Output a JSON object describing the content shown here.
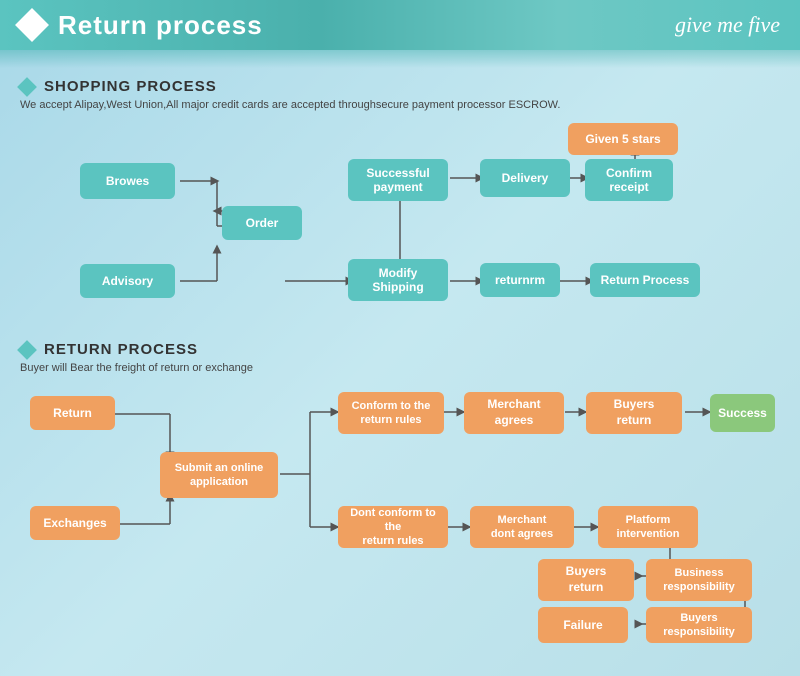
{
  "header": {
    "title": "Return process",
    "logo": "give me five"
  },
  "shopping_section": {
    "title": "SHOPPING PROCESS",
    "subtitle": "We accept Alipay,West Union,All major credit cards are accepted throughsecure payment processor ESCROW.",
    "boxes": [
      {
        "id": "browes",
        "label": "Browes",
        "type": "teal"
      },
      {
        "id": "order",
        "label": "Order",
        "type": "teal"
      },
      {
        "id": "advisory",
        "label": "Advisory",
        "type": "teal"
      },
      {
        "id": "successful_payment",
        "label": "Successful\npayment",
        "type": "teal"
      },
      {
        "id": "modify_shipping",
        "label": "Modify\nShipping",
        "type": "teal"
      },
      {
        "id": "delivery",
        "label": "Delivery",
        "type": "teal"
      },
      {
        "id": "confirm_receipt",
        "label": "Confirm\nreceipt",
        "type": "teal"
      },
      {
        "id": "given_5_stars",
        "label": "Given 5 stars",
        "type": "orange"
      },
      {
        "id": "returnrm",
        "label": "returnrm",
        "type": "teal"
      },
      {
        "id": "return_process",
        "label": "Return Process",
        "type": "teal"
      }
    ]
  },
  "return_section": {
    "title": "RETURN PROCESS",
    "subtitle": "Buyer will Bear the freight of return or exchange",
    "boxes": [
      {
        "id": "return",
        "label": "Return",
        "type": "orange"
      },
      {
        "id": "exchanges",
        "label": "Exchanges",
        "type": "orange"
      },
      {
        "id": "submit_online",
        "label": "Submit an online\napplication",
        "type": "orange"
      },
      {
        "id": "conform_rules",
        "label": "Conform to the\nreturn rules",
        "type": "orange"
      },
      {
        "id": "dont_conform",
        "label": "Dont conform to the\nreturn rules",
        "type": "orange"
      },
      {
        "id": "merchant_agrees",
        "label": "Merchant\nagrees",
        "type": "orange"
      },
      {
        "id": "merchant_dont",
        "label": "Merchant\ndont agrees",
        "type": "orange"
      },
      {
        "id": "buyers_return1",
        "label": "Buyers\nreturn",
        "type": "orange"
      },
      {
        "id": "platform",
        "label": "Platform\nintervention",
        "type": "orange"
      },
      {
        "id": "success",
        "label": "Success",
        "type": "green"
      },
      {
        "id": "buyers_return2",
        "label": "Buyers\nreturn",
        "type": "orange"
      },
      {
        "id": "business_resp",
        "label": "Business\nresponsibility",
        "type": "orange"
      },
      {
        "id": "failure",
        "label": "Failure",
        "type": "orange"
      },
      {
        "id": "buyers_resp",
        "label": "Buyers\nresponsibility",
        "type": "orange"
      }
    ]
  }
}
